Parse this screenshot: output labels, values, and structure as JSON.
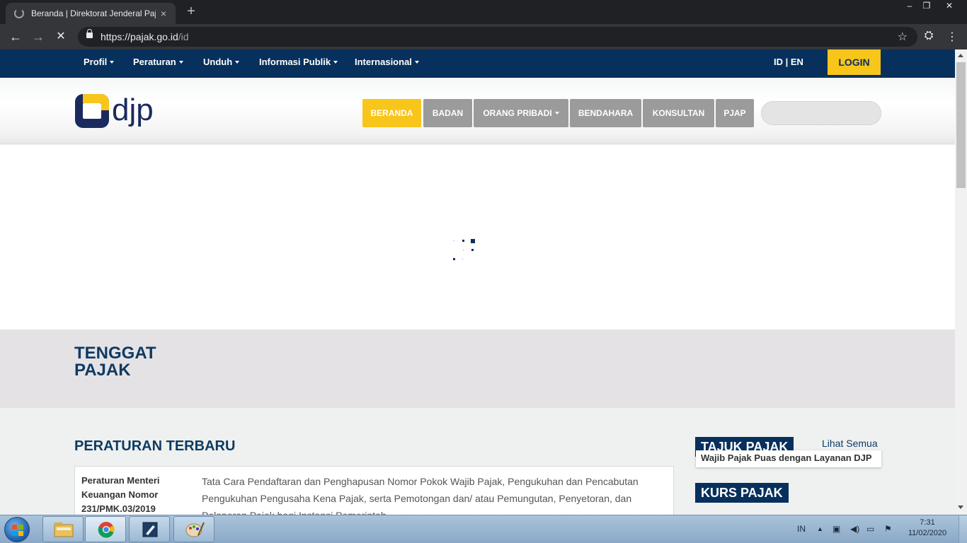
{
  "browser": {
    "tab_title": "Beranda | Direktorat Jenderal Pajak",
    "tab_close": "×",
    "new_tab": "+",
    "url_host": "https://pajak.go.id",
    "url_path": "/id",
    "win_min": "–",
    "win_max": "❐",
    "win_close": "✕",
    "back": "←",
    "forward": "→",
    "stop": "✕",
    "star": "☆",
    "ext": "⛭",
    "more": "⋮"
  },
  "topnav": {
    "menu": [
      {
        "label": "Profil"
      },
      {
        "label": "Peraturan"
      },
      {
        "label": "Unduh"
      },
      {
        "label": "Informasi Publik"
      },
      {
        "label": "Internasional"
      }
    ],
    "lang": "ID | EN",
    "login": "LOGIN"
  },
  "header": {
    "logo_text": "djp",
    "tabs": [
      {
        "label": "BERANDA",
        "active": true
      },
      {
        "label": "BADAN"
      },
      {
        "label": "ORANG PRIBADI",
        "dropdown": true
      },
      {
        "label": "BENDAHARA"
      },
      {
        "label": "KONSULTAN"
      },
      {
        "label": "PJAP"
      }
    ],
    "search_value": ""
  },
  "tenggat": {
    "title": "TENGGAT PAJAK"
  },
  "peraturan": {
    "title": "PERATURAN TERBARU",
    "items": [
      {
        "type": "Peraturan Menteri Keuangan Nomor 231/PMK.03/2019",
        "desc": "Tata Cara Pendaftaran dan Penghapusan Nomor Pokok Wajib Pajak, Pengukuhan dan Pencabutan Pengukuhan Pengusaha Kena Pajak, serta Pemotongan dan/ atau Pemungutan, Penyetoran, dan Pelaporan Pajak bagi Instansi Pemerintah"
      }
    ]
  },
  "sidebar": {
    "tajuk_title": "TAJUK PAJAK",
    "lihat_semua": "Lihat Semua",
    "tajuk_item": "Wajib Pajak Puas dengan Layanan DJP",
    "kurs_title": "KURS PAJAK"
  },
  "taskbar": {
    "lang": "IN",
    "time": "7:31",
    "date": "11/02/2020"
  },
  "colors": {
    "navy": "#07305c",
    "accent_yellow": "#f8c51b",
    "tab_gray": "#9b9b9b",
    "tenggat_bg": "#e5e2e5",
    "page_bg": "#eef1ef"
  }
}
